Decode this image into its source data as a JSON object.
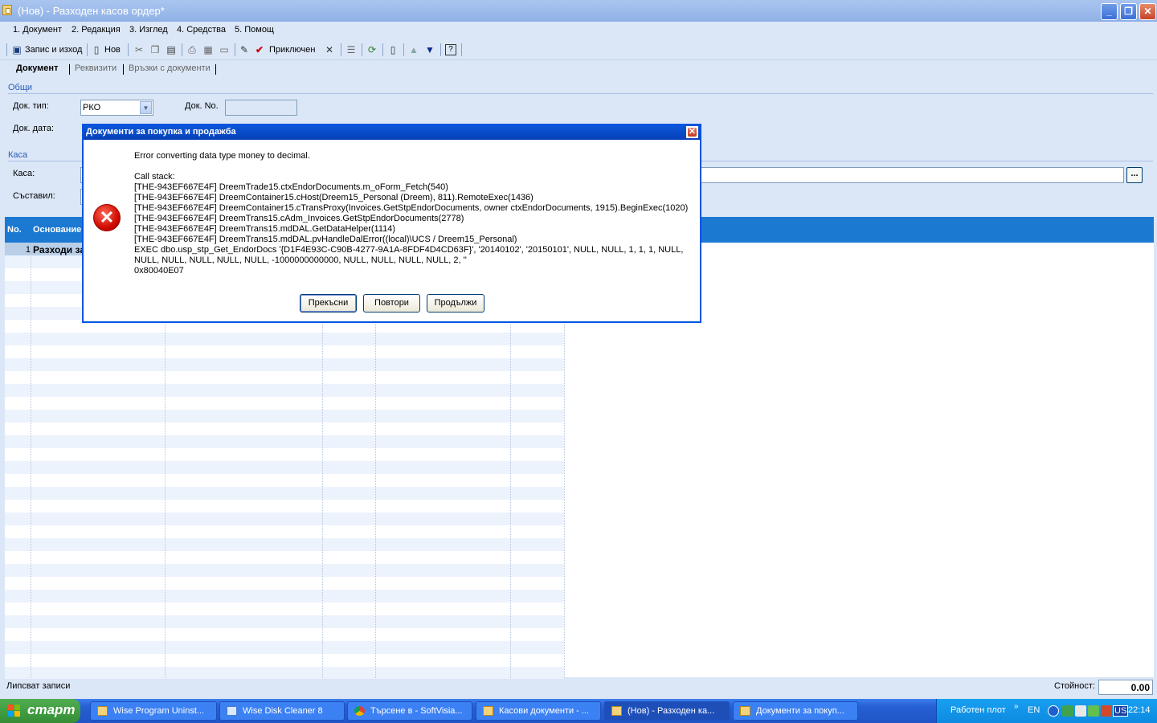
{
  "window": {
    "title": "(Нов) - Разходен касов ордер*",
    "minimize": "_",
    "restore": "❐",
    "close": "✕"
  },
  "menu": [
    "1. Документ",
    "2. Редакция",
    "3. Изглед",
    "4. Средства",
    "5. Помощ"
  ],
  "toolbar": {
    "save_exit": "Запис и изход",
    "new": "Нов",
    "finish": "Приключен"
  },
  "tabs": [
    "Документ",
    "Реквизити",
    "Връзки с документи"
  ],
  "sections": {
    "general": "Общи",
    "cashbox": "Каса"
  },
  "form": {
    "doc_type_label": "Док. тип:",
    "doc_type_value": "РКО",
    "doc_no_label": "Док. No.",
    "doc_no_value": "",
    "doc_date_label": "Док. дата:",
    "cashbox_label": "Каса:",
    "cashbox_button": "...",
    "author_label": "Съставил:"
  },
  "grid": {
    "headers": [
      "No.",
      "Основание"
    ],
    "rows": [
      {
        "no": "1",
        "text": "Разходи за"
      }
    ]
  },
  "status": {
    "text": "Липсват записи",
    "value_label": "Стойност:",
    "value": "0.00"
  },
  "dialog": {
    "title": "Документи за покупка и продажба",
    "message": "Error converting data type money to decimal.\n\nCall stack:\n[THE-943EF667E4F] DreemTrade15.ctxEndorDocuments.m_oForm_Fetch(540)\n[THE-943EF667E4F] DreemContainer15.cHost(Dreem15_Personal (Dreem), 811).RemoteExec(1436)\n[THE-943EF667E4F] DreemContainer15.cTransProxy(Invoices.GetStpEndorDocuments, owner ctxEndorDocuments, 1915).BeginExec(1020)\n[THE-943EF667E4F] DreemTrans15.cAdm_Invoices.GetStpEndorDocuments(2778)\n[THE-943EF667E4F] DreemTrans15.mdDAL.GetDataHelper(1114)\n[THE-943EF667E4F] DreemTrans15.mdDAL.pvHandleDalError((local)\\UCS / Dreem15_Personal)\nEXEC dbo.usp_stp_Get_EndorDocs '{D1F4E93C-C90B-4277-9A1A-8FDF4D4CD63F}', '20140102', '20150101', NULL, NULL, 1, 1, 1, NULL, NULL, NULL, NULL, NULL, NULL, -1000000000000, NULL, NULL, NULL, NULL, 2, ''\n0x80040E07",
    "buttons": [
      "Прекъсни",
      "Повтори",
      "Продължи"
    ]
  },
  "taskbar": {
    "start": "старт",
    "tasks": [
      {
        "label": "Wise Program Uninst..."
      },
      {
        "label": "Wise Disk Cleaner 8"
      },
      {
        "label": "Търсене в - SoftVisia..."
      },
      {
        "label": "Касови документи - ..."
      },
      {
        "label": "(Нов) - Разходен ка..."
      },
      {
        "label": "Документи за покуп..."
      }
    ],
    "desktop_label": "Работен плот",
    "lang": "EN",
    "layout": "US",
    "time": "22:14"
  },
  "colors": {
    "grid_header": "#1b79d2",
    "dialog_border": "#0054e3",
    "taskbar": "#2660d4",
    "start": "#358d35"
  }
}
